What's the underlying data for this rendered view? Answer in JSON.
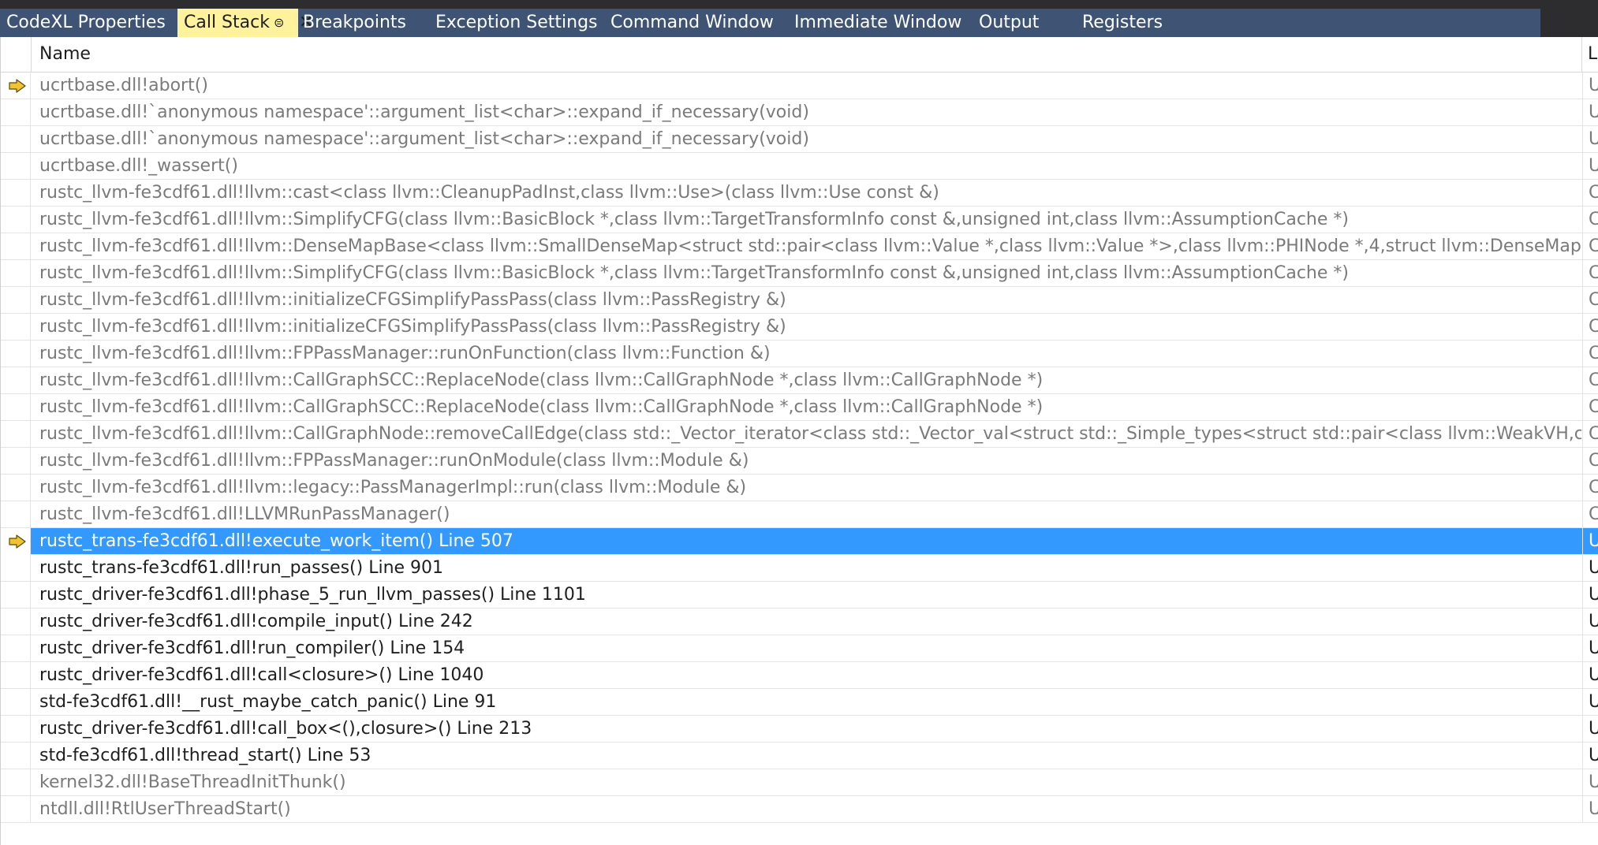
{
  "tabs": [
    {
      "label": "CodeXL Properties",
      "active": false
    },
    {
      "label": "Call Stack",
      "active": true
    },
    {
      "label": "Breakpoints",
      "active": false
    },
    {
      "label": "Exception Settings",
      "active": false
    },
    {
      "label": "Command Window",
      "active": false
    },
    {
      "label": "Immediate Window",
      "active": false
    },
    {
      "label": "Output",
      "active": false
    },
    {
      "label": "Registers",
      "active": false
    }
  ],
  "tab_icons": {
    "pin": "pin-icon",
    "close": "close-icon"
  },
  "columns": {
    "name": "Name",
    "lang": "L"
  },
  "rows": [
    {
      "name": "ucrtbase.dll!abort()",
      "lang": "U",
      "marker": "current-frame-arrow-icon"
    },
    {
      "name": "ucrtbase.dll!`anonymous namespace'::argument_list<char>::expand_if_necessary(void)",
      "lang": "U"
    },
    {
      "name": "ucrtbase.dll!`anonymous namespace'::argument_list<char>::expand_if_necessary(void)",
      "lang": "U"
    },
    {
      "name": "ucrtbase.dll!_wassert()",
      "lang": "U"
    },
    {
      "name": "rustc_llvm-fe3cdf61.dll!llvm::cast<class llvm::CleanupPadInst,class llvm::Use>(class llvm::Use const &)",
      "lang": "C"
    },
    {
      "name": "rustc_llvm-fe3cdf61.dll!llvm::SimplifyCFG(class llvm::BasicBlock *,class llvm::TargetTransformInfo const &,unsigned int,class llvm::AssumptionCache *)",
      "lang": "C"
    },
    {
      "name": "rustc_llvm-fe3cdf61.dll!llvm::DenseMapBase<class llvm::SmallDenseMap<struct std::pair<class llvm::Value *,class llvm::Value *>,class llvm::PHINode *,4,struct llvm::DenseMapInfo<struct",
      "lang": "C"
    },
    {
      "name": "rustc_llvm-fe3cdf61.dll!llvm::SimplifyCFG(class llvm::BasicBlock *,class llvm::TargetTransformInfo const &,unsigned int,class llvm::AssumptionCache *)",
      "lang": "C"
    },
    {
      "name": "rustc_llvm-fe3cdf61.dll!llvm::initializeCFGSimplifyPassPass(class llvm::PassRegistry &)",
      "lang": "C"
    },
    {
      "name": "rustc_llvm-fe3cdf61.dll!llvm::initializeCFGSimplifyPassPass(class llvm::PassRegistry &)",
      "lang": "C"
    },
    {
      "name": "rustc_llvm-fe3cdf61.dll!llvm::FPPassManager::runOnFunction(class llvm::Function &)",
      "lang": "C"
    },
    {
      "name": "rustc_llvm-fe3cdf61.dll!llvm::CallGraphSCC::ReplaceNode(class llvm::CallGraphNode *,class llvm::CallGraphNode *)",
      "lang": "C"
    },
    {
      "name": "rustc_llvm-fe3cdf61.dll!llvm::CallGraphSCC::ReplaceNode(class llvm::CallGraphNode *,class llvm::CallGraphNode *)",
      "lang": "C"
    },
    {
      "name": "rustc_llvm-fe3cdf61.dll!llvm::CallGraphNode::removeCallEdge(class std::_Vector_iterator<class std::_Vector_val<struct std::_Simple_types<struct std::pair<class llvm::WeakVH,class llvm::Ca",
      "lang": "C"
    },
    {
      "name": "rustc_llvm-fe3cdf61.dll!llvm::FPPassManager::runOnModule(class llvm::Module &)",
      "lang": "C"
    },
    {
      "name": "rustc_llvm-fe3cdf61.dll!llvm::legacy::PassManagerImpl::run(class llvm::Module &)",
      "lang": "C"
    },
    {
      "name": "rustc_llvm-fe3cdf61.dll!LLVMRunPassManager()",
      "lang": "C"
    },
    {
      "name": "rustc_trans-fe3cdf61.dll!execute_work_item() Line 507",
      "lang": "U",
      "selected": true,
      "user": true,
      "marker": "selected-frame-arrow-icon"
    },
    {
      "name": "rustc_trans-fe3cdf61.dll!run_passes() Line 901",
      "lang": "U",
      "user": true
    },
    {
      "name": "rustc_driver-fe3cdf61.dll!phase_5_run_llvm_passes() Line 1101",
      "lang": "U",
      "user": true
    },
    {
      "name": "rustc_driver-fe3cdf61.dll!compile_input() Line 242",
      "lang": "U",
      "user": true
    },
    {
      "name": "rustc_driver-fe3cdf61.dll!run_compiler() Line 154",
      "lang": "U",
      "user": true
    },
    {
      "name": "rustc_driver-fe3cdf61.dll!call<closure>() Line 1040",
      "lang": "U",
      "user": true
    },
    {
      "name": "std-fe3cdf61.dll!__rust_maybe_catch_panic() Line 91",
      "lang": "U",
      "user": true
    },
    {
      "name": "rustc_driver-fe3cdf61.dll!call_box<(),closure>() Line 213",
      "lang": "U",
      "user": true
    },
    {
      "name": "std-fe3cdf61.dll!thread_start() Line 53",
      "lang": "U",
      "user": true
    },
    {
      "name": "kernel32.dll!BaseThreadInitThunk()",
      "lang": "U"
    },
    {
      "name": "ntdll.dll!RtlUserThreadStart()",
      "lang": "U"
    }
  ],
  "colors": {
    "tab_strip": "#3f5474",
    "active_tab": "#fff29d",
    "selection": "#3399ff",
    "arrow": "#f1c232"
  }
}
